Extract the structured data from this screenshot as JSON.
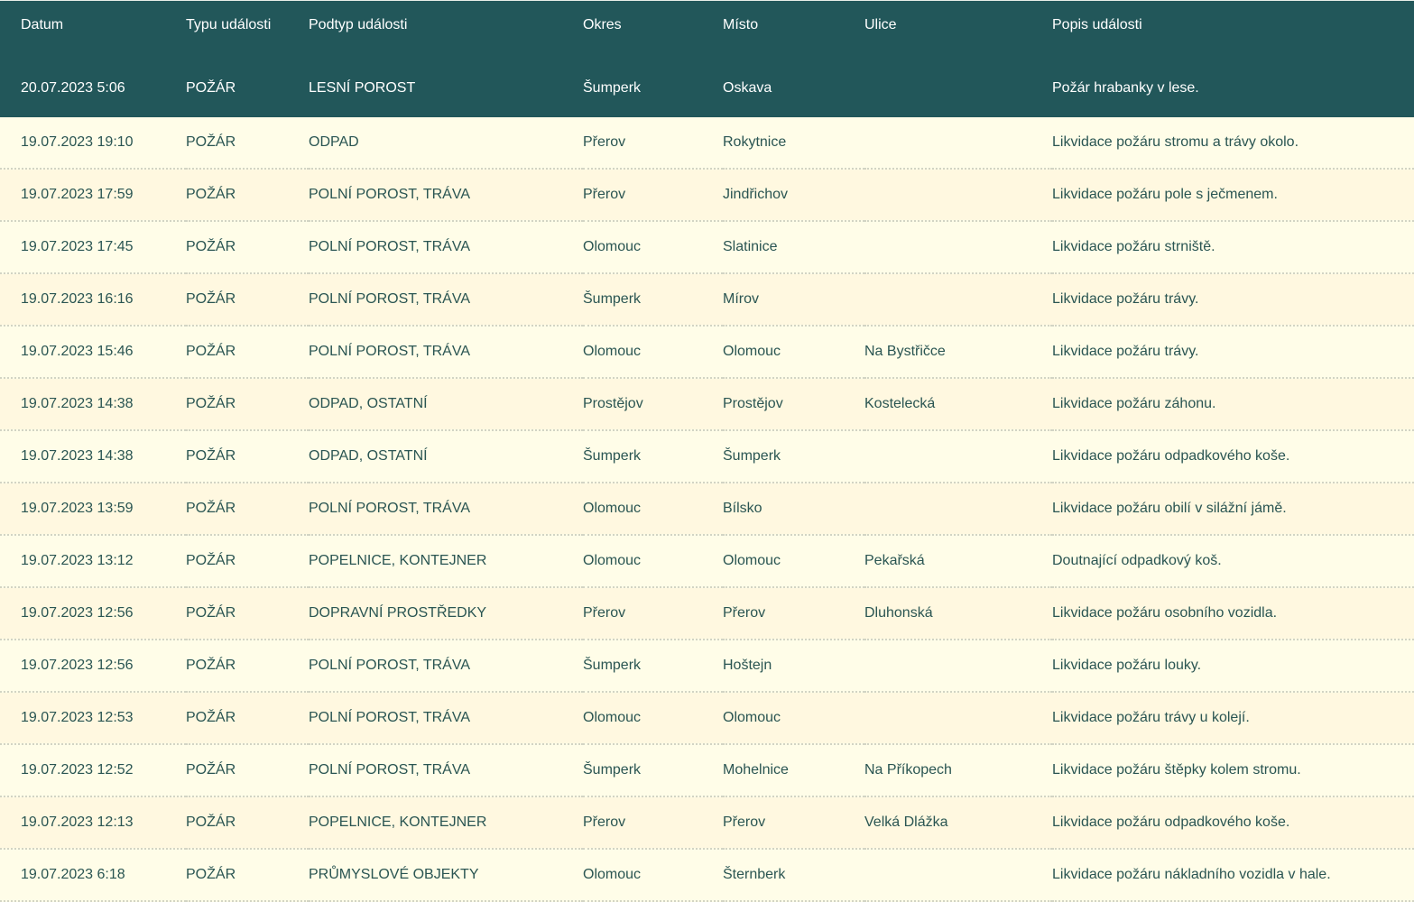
{
  "table": {
    "headers": {
      "date": "Datum",
      "type": "Typu události",
      "subtype": "Podtyp události",
      "okres": "Okres",
      "misto": "Místo",
      "ulice": "Ulice",
      "popis": "Popis události"
    },
    "highlighted": {
      "date": "20.07.2023 5:06",
      "type": "POŽÁR",
      "subtype": "LESNÍ POROST",
      "okres": "Šumperk",
      "misto": "Oskava",
      "ulice": "",
      "popis": "Požár hrabanky v lese."
    },
    "rows": [
      {
        "date": "19.07.2023 19:10",
        "type": "POŽÁR",
        "subtype": "ODPAD",
        "okres": "Přerov",
        "misto": "Rokytnice",
        "ulice": "",
        "popis": "Likvidace požáru stromu a trávy okolo."
      },
      {
        "date": "19.07.2023 17:59",
        "type": "POŽÁR",
        "subtype": "POLNÍ POROST, TRÁVA",
        "okres": "Přerov",
        "misto": "Jindřichov",
        "ulice": "",
        "popis": "Likvidace požáru pole s ječmenem."
      },
      {
        "date": "19.07.2023 17:45",
        "type": "POŽÁR",
        "subtype": "POLNÍ POROST, TRÁVA",
        "okres": "Olomouc",
        "misto": "Slatinice",
        "ulice": "",
        "popis": "Likvidace požáru strniště."
      },
      {
        "date": "19.07.2023 16:16",
        "type": "POŽÁR",
        "subtype": "POLNÍ POROST, TRÁVA",
        "okres": "Šumperk",
        "misto": "Mírov",
        "ulice": "",
        "popis": "Likvidace požáru trávy."
      },
      {
        "date": "19.07.2023 15:46",
        "type": "POŽÁR",
        "subtype": "POLNÍ POROST, TRÁVA",
        "okres": "Olomouc",
        "misto": "Olomouc",
        "ulice": "Na Bystřičce",
        "popis": "Likvidace požáru trávy."
      },
      {
        "date": "19.07.2023 14:38",
        "type": "POŽÁR",
        "subtype": "ODPAD, OSTATNÍ",
        "okres": "Prostějov",
        "misto": "Prostějov",
        "ulice": "Kostelecká",
        "popis": "Likvidace požáru záhonu."
      },
      {
        "date": "19.07.2023 14:38",
        "type": "POŽÁR",
        "subtype": "ODPAD, OSTATNÍ",
        "okres": "Šumperk",
        "misto": "Šumperk",
        "ulice": "",
        "popis": "Likvidace požáru odpadkového koše."
      },
      {
        "date": "19.07.2023 13:59",
        "type": "POŽÁR",
        "subtype": "POLNÍ POROST, TRÁVA",
        "okres": "Olomouc",
        "misto": "Bílsko",
        "ulice": "",
        "popis": "Likvidace požáru obilí v silážní jámě."
      },
      {
        "date": "19.07.2023 13:12",
        "type": "POŽÁR",
        "subtype": "POPELNICE, KONTEJNER",
        "okres": "Olomouc",
        "misto": "Olomouc",
        "ulice": "Pekařská",
        "popis": "Doutnající odpadkový koš."
      },
      {
        "date": "19.07.2023 12:56",
        "type": "POŽÁR",
        "subtype": "DOPRAVNÍ PROSTŘEDKY",
        "okres": "Přerov",
        "misto": "Přerov",
        "ulice": "Dluhonská",
        "popis": "Likvidace požáru osobního vozidla."
      },
      {
        "date": "19.07.2023 12:56",
        "type": "POŽÁR",
        "subtype": "POLNÍ POROST, TRÁVA",
        "okres": "Šumperk",
        "misto": "Hoštejn",
        "ulice": "",
        "popis": "Likvidace požáru louky."
      },
      {
        "date": "19.07.2023 12:53",
        "type": "POŽÁR",
        "subtype": "POLNÍ POROST, TRÁVA",
        "okres": "Olomouc",
        "misto": "Olomouc",
        "ulice": "",
        "popis": "Likvidace požáru trávy u kolejí."
      },
      {
        "date": "19.07.2023 12:52",
        "type": "POŽÁR",
        "subtype": "POLNÍ POROST, TRÁVA",
        "okres": "Šumperk",
        "misto": "Mohelnice",
        "ulice": "Na Příkopech",
        "popis": "Likvidace požáru štěpky kolem stromu."
      },
      {
        "date": "19.07.2023 12:13",
        "type": "POŽÁR",
        "subtype": "POPELNICE, KONTEJNER",
        "okres": "Přerov",
        "misto": "Přerov",
        "ulice": "Velká Dlážka",
        "popis": "Likvidace požáru odpadkového koše."
      },
      {
        "date": "19.07.2023 6:18",
        "type": "POŽÁR",
        "subtype": "PRŮMYSLOVÉ OBJEKTY",
        "okres": "Olomouc",
        "misto": "Šternberk",
        "ulice": "",
        "popis": "Likvidace požáru nákladního vozidla v hale."
      }
    ]
  },
  "colors": {
    "header_bg": "#22575a",
    "header_text": "#ffffff",
    "row_odd_bg": "#fffde8",
    "row_even_bg": "#fff8e0",
    "body_text": "#2a5552"
  }
}
